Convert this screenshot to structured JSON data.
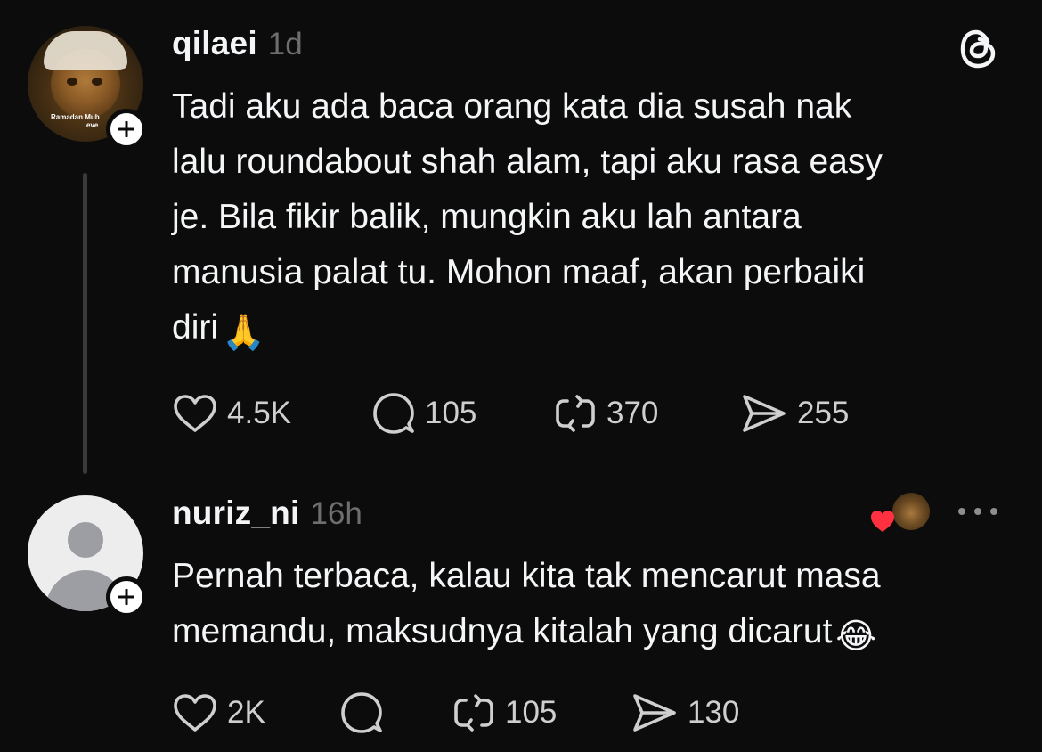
{
  "posts": [
    {
      "username": "qilaei",
      "timestamp": "1d",
      "text": "Tadi aku ada baca orang kata dia susah nak\nlalu roundabout shah alam, tapi aku rasa easy\nje. Bila fikir balik, mungkin aku lah antara\nmanusia palat tu. Mohon maaf, akan perbaiki\ndiri",
      "text_emoji": "🙏",
      "avatar_caption_line1": "Ramadan Mub",
      "avatar_caption_line2": "eve",
      "likes": "4.5K",
      "replies": "105",
      "reposts": "370",
      "shares": "255"
    },
    {
      "username": "nuriz_ni",
      "timestamp": "16h",
      "text": "Pernah terbaca, kalau kita tak mencarut masa\nmemandu, maksudnya kitalah yang dicarut",
      "text_emoji": "😂",
      "likes": "2K",
      "replies": "",
      "reposts": "105",
      "shares": "130"
    }
  ],
  "colors": {
    "background": "#0c0c0c",
    "text": "#f3f5f7",
    "muted": "#6e6e6e",
    "liked_heart": "#ff3040"
  },
  "icons": [
    "heart-icon",
    "comment-icon",
    "repost-icon",
    "share-icon",
    "threads-logo-icon",
    "plus-icon",
    "more-icon"
  ]
}
